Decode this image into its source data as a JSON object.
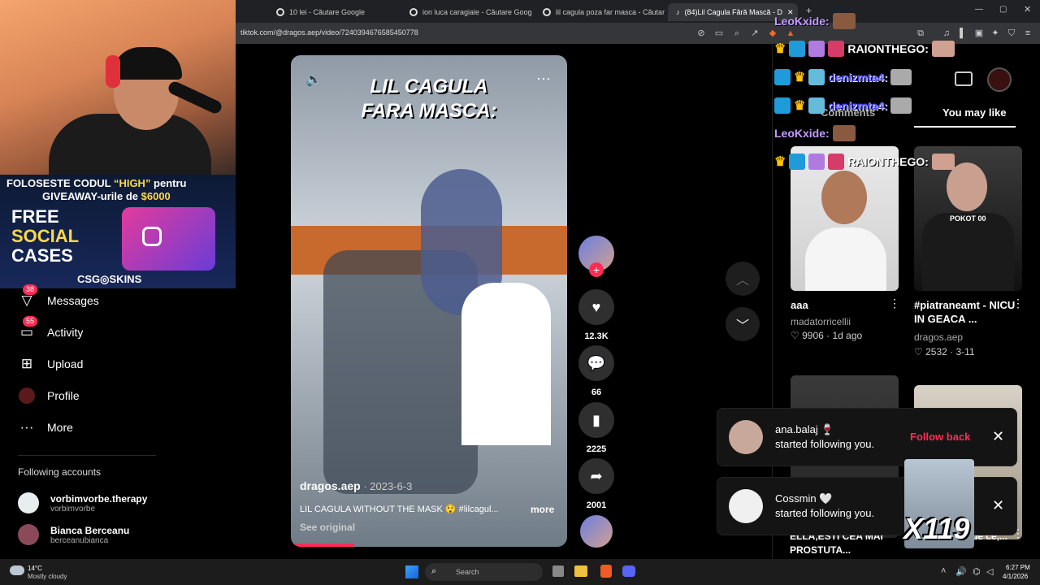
{
  "browser": {
    "tabs": [
      {
        "title": "10 lei - Căutare Google"
      },
      {
        "title": "ion luca caragiale - Căutare Google"
      },
      {
        "title": "lil cagula poza far masca - Căutare G"
      },
      {
        "title": "(84)Lil Cagula Fără Mască - D"
      }
    ],
    "new_tab": "+",
    "url": "tiktok.com/@dragos.aep/video/7240394676585450778"
  },
  "ad": {
    "line1_a": "FOLOSESTE CODUL ",
    "line1_code": "“HIGH”",
    "line1_b": " pentru",
    "line2_a": "GIVEAWAY-urile de ",
    "line2_amount": "$6000",
    "free": "FREE",
    "social": "SOCIAL",
    "cases": "CASES",
    "brand": "CSG◎SKINS"
  },
  "nav": {
    "messages": {
      "label": "Messages",
      "badge": "38"
    },
    "activity": {
      "label": "Activity",
      "badge": "55"
    },
    "upload": {
      "label": "Upload"
    },
    "profile": {
      "label": "Profile"
    },
    "more": {
      "label": "More"
    }
  },
  "following": {
    "title": "Following accounts",
    "accounts": [
      {
        "name": "vorbimvorbe.therapy",
        "username": "vorbimvorbe"
      },
      {
        "name": "Bianca Berceanu",
        "username": "berceanubianca"
      }
    ]
  },
  "video": {
    "overlay_title_1": "LIL CAGULA",
    "overlay_title_2": "FARA MASCA:",
    "author": "dragos.aep",
    "date": " · 2023-6-3",
    "caption": "LIL CAGULA WITHOUT THE MASK 😲 #lilcagul...",
    "more": "more",
    "see_original": "See original",
    "progress": 0.23
  },
  "actions": {
    "likes": "12.3K",
    "comments": "66",
    "saves": "2225",
    "shares": "2001",
    "follow_plus": "+"
  },
  "panel": {
    "tab_comments": "Comments",
    "tab_you_may_like": "You may like",
    "cards": [
      {
        "title": "aaa",
        "author": "madatorricellii",
        "likes": "9906",
        "date": "1d ago"
      },
      {
        "title": "#piatraneamt - NICU IN GEACA ...",
        "author": "dragos.aep",
        "likes": "2532",
        "date": "3-11",
        "thumb_text": "POKOT 00"
      },
      {
        "title": "ELLA,ESTI CEA MAI PROSTUTA..."
      },
      {
        "title": "vreodată de ce,..."
      }
    ]
  },
  "chat": {
    "lines": [
      {
        "name": "LeoKxide:"
      },
      {
        "name": "RAIONTHEGO:"
      },
      {
        "name": "denizmta4:"
      },
      {
        "name": "denizmta4:"
      },
      {
        "name": "LeoKxide:"
      },
      {
        "name": "RAIONTHEGO:"
      }
    ],
    "combo": "X119"
  },
  "notifications": [
    {
      "name": "ana.balaj 🍷",
      "text": "started following you.",
      "action": "Follow back"
    },
    {
      "name": "Cossmin 🤍",
      "text": "started following you."
    }
  ],
  "taskbar": {
    "weather_temp": "14°C",
    "weather_desc": "Mostly cloudy",
    "search_placeholder": "Search",
    "time": "6:27 PM",
    "date": "4/1/2026"
  },
  "colors": {
    "accent": "#fe2c55",
    "bg": "#000000",
    "ad_yellow": "#ffd84a"
  }
}
